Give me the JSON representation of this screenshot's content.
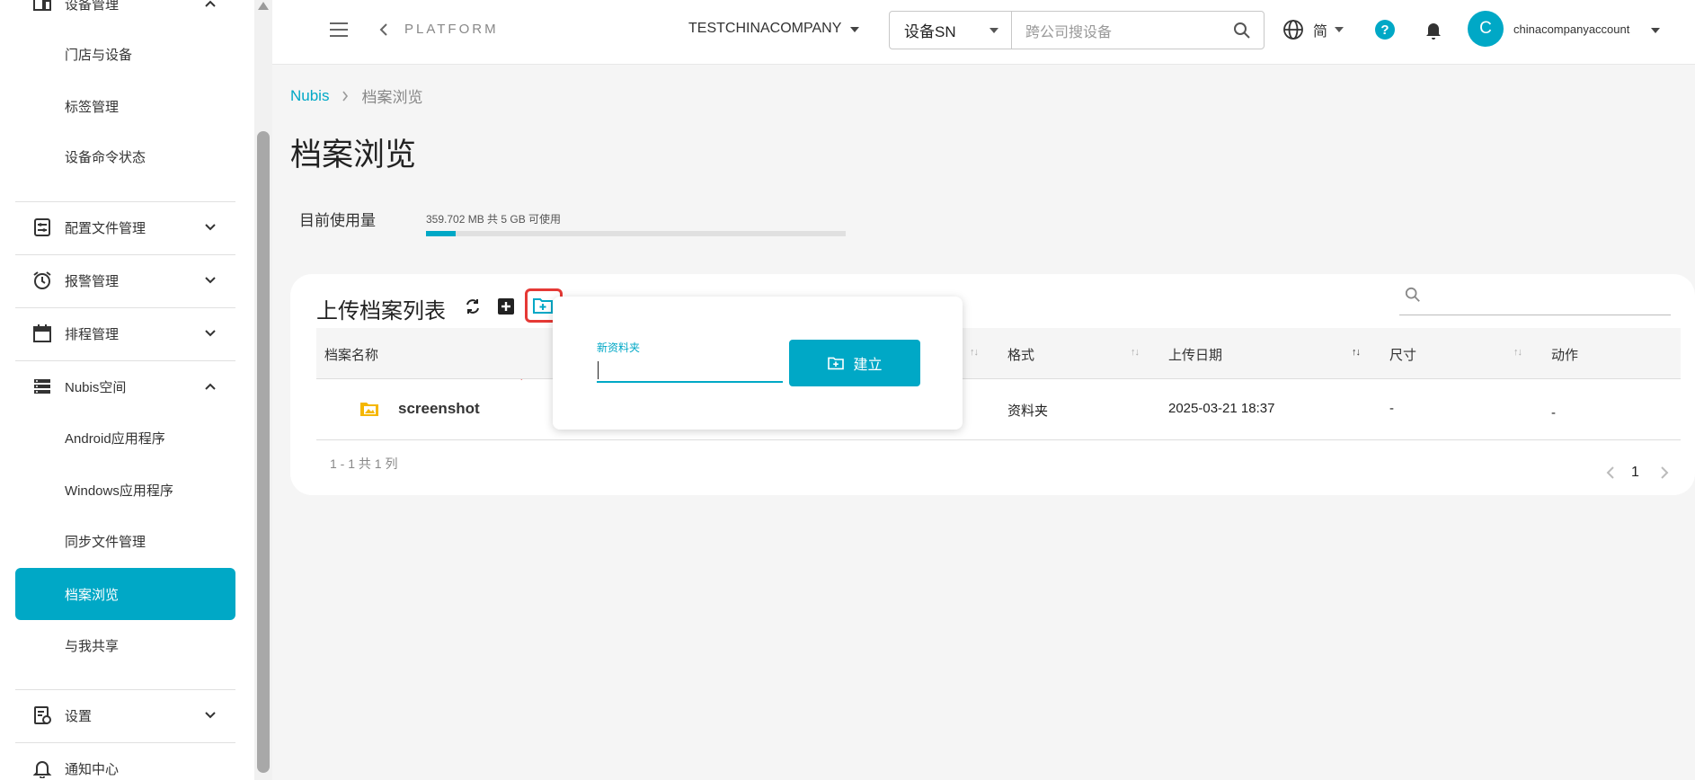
{
  "colors": {
    "accent": "#00a8c6",
    "highlight": "#e53935"
  },
  "sidebar": {
    "items": [
      {
        "label": "设备管理",
        "icon": "device-icon"
      },
      {
        "label": "门店与设备"
      },
      {
        "label": "标签管理"
      },
      {
        "label": "设备命令状态"
      },
      {
        "label": "配置文件管理",
        "icon": "config-file-icon"
      },
      {
        "label": "报警管理",
        "icon": "alarm-clock-icon"
      },
      {
        "label": "排程管理",
        "icon": "calendar-icon"
      },
      {
        "label": "Nubis空间",
        "icon": "storage-icon"
      },
      {
        "label": "Android应用程序"
      },
      {
        "label": "Windows应用程序"
      },
      {
        "label": "同步文件管理"
      },
      {
        "label": "档案浏览",
        "active": true
      },
      {
        "label": "与我共享"
      },
      {
        "label": "设置",
        "icon": "settings-doc-icon"
      },
      {
        "label": "通知中心",
        "icon": "bell-icon"
      }
    ]
  },
  "header": {
    "platform": "PLATFORM",
    "company": "TESTCHINACOMPANY",
    "search_type": "设备SN",
    "search_placeholder": "跨公司搜设备",
    "language": "简",
    "help": "?",
    "avatar_letter": "C",
    "account": "chinacompanyaccount"
  },
  "breadcrumb": {
    "home": "Nubis",
    "current": "档案浏览"
  },
  "page": {
    "title": "档案浏览",
    "usage_label": "目前使用量",
    "usage_text": "359.702 MB 共 5 GB 可使用",
    "usage_fraction": 0.07
  },
  "card": {
    "title": "上传档案列表",
    "columns": [
      "档案名称",
      "格式",
      "上传日期",
      "尺寸",
      "动作"
    ],
    "rows": [
      {
        "name": "screenshot",
        "format": "资料夹",
        "date": "2025-03-21 18:37",
        "size": "-",
        "action": "-"
      }
    ],
    "pagination_info": "1 - 1 共 1 列",
    "page": "1"
  },
  "popover": {
    "label": "新资料夹",
    "value": "",
    "button": "建立"
  }
}
